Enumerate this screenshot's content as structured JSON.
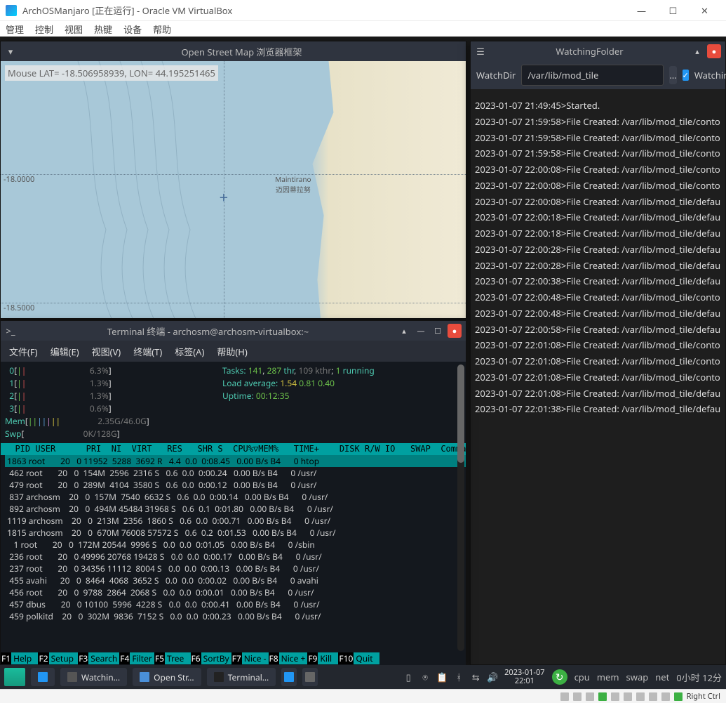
{
  "vb": {
    "title": "ArchOSManjaro [正在运行] - Oracle VM VirtualBox",
    "menu": [
      "管理",
      "控制",
      "视图",
      "热键",
      "设备",
      "帮助"
    ],
    "status_hostkey": "Right Ctrl"
  },
  "osm": {
    "title": "Open Street Map 浏览器框架",
    "coords": "Mouse LAT= -18.506958939, LON=  44.195251465",
    "latlabels": [
      "-18.0000",
      "-18.5000"
    ],
    "city": "Maintirano",
    "city_sub": "迈因蒂拉努"
  },
  "wf": {
    "title": "WatchingFolder",
    "dir_label": "WatchDir",
    "dir_value": "/var/lib/mod_tile",
    "watching_label": "Watching",
    "logs": [
      "2023-01-07 21:49:45>Started.",
      "2023-01-07 21:59:58>File Created: /var/lib/mod_tile/conto",
      "2023-01-07 21:59:58>File Created: /var/lib/mod_tile/conto",
      "2023-01-07 21:59:58>File Created: /var/lib/mod_tile/conto",
      "2023-01-07 22:00:08>File Created: /var/lib/mod_tile/conto",
      "2023-01-07 22:00:08>File Created: /var/lib/mod_tile/conto",
      "2023-01-07 22:00:08>File Created: /var/lib/mod_tile/defau",
      "2023-01-07 22:00:18>File Created: /var/lib/mod_tile/defau",
      "2023-01-07 22:00:18>File Created: /var/lib/mod_tile/defau",
      "2023-01-07 22:00:28>File Created: /var/lib/mod_tile/defau",
      "2023-01-07 22:00:28>File Created: /var/lib/mod_tile/defau",
      "2023-01-07 22:00:38>File Created: /var/lib/mod_tile/defau",
      "2023-01-07 22:00:48>File Created: /var/lib/mod_tile/conto",
      "2023-01-07 22:00:48>File Created: /var/lib/mod_tile/defau",
      "2023-01-07 22:00:58>File Created: /var/lib/mod_tile/defau",
      "2023-01-07 22:01:08>File Created: /var/lib/mod_tile/conto",
      "2023-01-07 22:01:08>File Created: /var/lib/mod_tile/conto",
      "2023-01-07 22:01:08>File Created: /var/lib/mod_tile/conto",
      "2023-01-07 22:01:08>File Created: /var/lib/mod_tile/defau",
      "2023-01-07 22:01:38>File Created: /var/lib/mod_tile/defau"
    ]
  },
  "term": {
    "title": "Terminal 终端 - archosm@archosm-virtualbox:~",
    "menu": [
      "文件(F)",
      "编辑(E)",
      "视图(V)",
      "终端(T)",
      "标签(A)",
      "帮助(H)"
    ],
    "cpu": [
      {
        "n": "0",
        "pct": "6.3%"
      },
      {
        "n": "1",
        "pct": "1.3%"
      },
      {
        "n": "2",
        "pct": "1.3%"
      },
      {
        "n": "3",
        "pct": "0.6%"
      }
    ],
    "mem": "2.35G/46.0G",
    "swp": "0K/128G",
    "tasks": {
      "p": "141",
      "t": "287",
      "k": "109",
      "r": "1"
    },
    "load": [
      "1.54",
      "0.81",
      "0.40"
    ],
    "uptime": "00:12:35",
    "hdr": "  PID USER      PRI  NI  VIRT   RES   SHR S  CPU%▽MEM%   TIME+    DISK R/W IO   SWAP  Comma",
    "rows": [
      " 1863 root       20   0 11952  5288  3692 R   4.4  0.0  0:08.45   0.00 B/s B4      0 htop ",
      "  462 root       20   0  154M  2596  2316 S   0.6  0.0  0:00.24   0.00 B/s B4      0 /usr/",
      "  479 root       20   0  289M  4104  3580 S   0.6  0.0  0:00.12   0.00 B/s B4      0 /usr/",
      "  837 archosm    20   0  157M  7540  6632 S   0.6  0.0  0:00.14   0.00 B/s B4      0 /usr/",
      "  892 archosm    20   0  494M 45484 31968 S   0.6  0.1  0:01.80   0.00 B/s B4      0 /usr/",
      " 1119 archosm    20   0  213M  2356  1860 S   0.6  0.0  0:00.71   0.00 B/s B4      0 /usr/",
      " 1815 archosm    20   0  670M 76008 57572 S   0.6  0.2  0:01.53   0.00 B/s B4      0 /usr/",
      "    1 root       20   0  172M 20544  9996 S   0.0  0.0  0:01.05   0.00 B/s B4      0 /sbin",
      "  236 root       20   0 49996 20768 19428 S   0.0  0.0  0:00.17   0.00 B/s B4      0 /usr/",
      "  237 root       20   0 34356 11112  8004 S   0.0  0.0  0:00.13   0.00 B/s B4      0 /usr/",
      "  455 avahi      20   0  8464  4068  3652 S   0.0  0.0  0:00.02   0.00 B/s B4      0 avahi",
      "  456 root       20   0  9788  2864  2068 S   0.0  0.0  0:00.01   0.00 B/s B4      0 /usr/",
      "  457 dbus       20   0 10100  5996  4228 S   0.0  0.0  0:00.41   0.00 B/s B4      0 /usr/",
      "  459 polkitd    20   0  302M  9836  7152 S   0.0  0.0  0:00.23   0.00 B/s B4      0 /usr/"
    ],
    "fn": [
      [
        "F1",
        "Help"
      ],
      [
        "F2",
        "Setup"
      ],
      [
        "F3",
        "Search"
      ],
      [
        "F4",
        "Filter"
      ],
      [
        "F5",
        "Tree"
      ],
      [
        "F6",
        "SortBy"
      ],
      [
        "F7",
        "Nice -"
      ],
      [
        "F8",
        "Nice +"
      ],
      [
        "F9",
        "Kill"
      ],
      [
        "F10",
        "Quit"
      ]
    ]
  },
  "taskbar": {
    "items": [
      "Watchin…",
      "Open Str…",
      "Terminal…"
    ],
    "clock_date": "2023-01-07",
    "clock_time": "22:01",
    "monitors": [
      "cpu",
      "mem",
      "swap",
      "net"
    ],
    "uptime": "0小时 12分"
  }
}
